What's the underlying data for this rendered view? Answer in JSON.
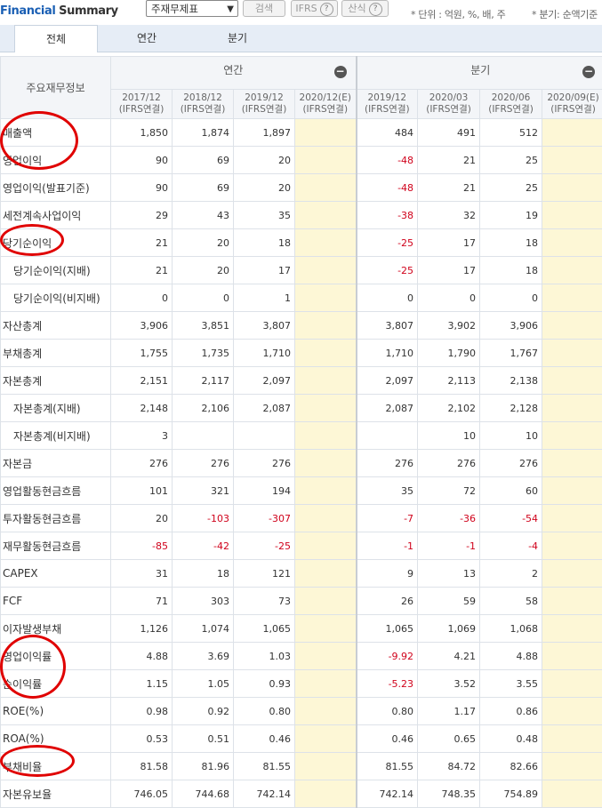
{
  "header": {
    "title_brand": "Financial",
    "title_rest": "Summary",
    "select_value": "주재무제표",
    "search_button": "검색",
    "ifrs_button": "IFRS",
    "formula_button": "산식",
    "help_mark": "?",
    "unit_note": "* 단위 : 억원, %, 배, 주",
    "quarter_note": "* 분기: 순액기준"
  },
  "tabs": [
    "전체",
    "연간",
    "분기"
  ],
  "table": {
    "corner_label": "주요재무정보",
    "group_annual": "연간",
    "group_quarter": "분기",
    "collapse_mark": "−",
    "periods": [
      {
        "date": "2017/12",
        "std": "(IFRS연결)"
      },
      {
        "date": "2018/12",
        "std": "(IFRS연결)"
      },
      {
        "date": "2019/12",
        "std": "(IFRS연결)"
      },
      {
        "date": "2020/12(E)",
        "std": "(IFRS연결)"
      },
      {
        "date": "2019/12",
        "std": "(IFRS연결)"
      },
      {
        "date": "2020/03",
        "std": "(IFRS연결)"
      },
      {
        "date": "2020/06",
        "std": "(IFRS연결)"
      },
      {
        "date": "2020/09(E)",
        "std": "(IFRS연결)"
      }
    ],
    "rows": [
      {
        "label": "매출액",
        "indent": false,
        "values": [
          "1,850",
          "1,874",
          "1,897",
          "",
          "484",
          "491",
          "512",
          ""
        ]
      },
      {
        "label": "영업이익",
        "indent": false,
        "values": [
          "90",
          "69",
          "20",
          "",
          "-48",
          "21",
          "25",
          ""
        ]
      },
      {
        "label": "영업이익(발표기준)",
        "indent": false,
        "values": [
          "90",
          "69",
          "20",
          "",
          "-48",
          "21",
          "25",
          ""
        ]
      },
      {
        "label": "세전계속사업이익",
        "indent": false,
        "values": [
          "29",
          "43",
          "35",
          "",
          "-38",
          "32",
          "19",
          ""
        ]
      },
      {
        "label": "당기순이익",
        "indent": false,
        "values": [
          "21",
          "20",
          "18",
          "",
          "-25",
          "17",
          "18",
          ""
        ]
      },
      {
        "label": "당기순이익(지배)",
        "indent": true,
        "values": [
          "21",
          "20",
          "17",
          "",
          "-25",
          "17",
          "18",
          ""
        ]
      },
      {
        "label": "당기순이익(비지배)",
        "indent": true,
        "values": [
          "0",
          "0",
          "1",
          "",
          "0",
          "0",
          "0",
          ""
        ]
      },
      {
        "label": "자산총계",
        "indent": false,
        "values": [
          "3,906",
          "3,851",
          "3,807",
          "",
          "3,807",
          "3,902",
          "3,906",
          ""
        ]
      },
      {
        "label": "부채총계",
        "indent": false,
        "values": [
          "1,755",
          "1,735",
          "1,710",
          "",
          "1,710",
          "1,790",
          "1,767",
          ""
        ]
      },
      {
        "label": "자본총계",
        "indent": false,
        "values": [
          "2,151",
          "2,117",
          "2,097",
          "",
          "2,097",
          "2,113",
          "2,138",
          ""
        ]
      },
      {
        "label": "자본총계(지배)",
        "indent": true,
        "values": [
          "2,148",
          "2,106",
          "2,087",
          "",
          "2,087",
          "2,102",
          "2,128",
          ""
        ]
      },
      {
        "label": "자본총계(비지배)",
        "indent": true,
        "values": [
          "3",
          "",
          "",
          "",
          "",
          "10",
          "10",
          ""
        ]
      },
      {
        "label": "자본금",
        "indent": false,
        "values": [
          "276",
          "276",
          "276",
          "",
          "276",
          "276",
          "276",
          ""
        ]
      },
      {
        "label": "영업활동현금흐름",
        "indent": false,
        "values": [
          "101",
          "321",
          "194",
          "",
          "35",
          "72",
          "60",
          ""
        ]
      },
      {
        "label": "투자활동현금흐름",
        "indent": false,
        "values": [
          "20",
          "-103",
          "-307",
          "",
          "-7",
          "-36",
          "-54",
          ""
        ]
      },
      {
        "label": "재무활동현금흐름",
        "indent": false,
        "values": [
          "-85",
          "-42",
          "-25",
          "",
          "-1",
          "-1",
          "-4",
          ""
        ]
      },
      {
        "label": "CAPEX",
        "indent": false,
        "values": [
          "31",
          "18",
          "121",
          "",
          "9",
          "13",
          "2",
          ""
        ]
      },
      {
        "label": "FCF",
        "indent": false,
        "values": [
          "71",
          "303",
          "73",
          "",
          "26",
          "59",
          "58",
          ""
        ]
      },
      {
        "label": "이자발생부채",
        "indent": false,
        "values": [
          "1,126",
          "1,074",
          "1,065",
          "",
          "1,065",
          "1,069",
          "1,068",
          ""
        ]
      },
      {
        "label": "영업이익률",
        "indent": false,
        "values": [
          "4.88",
          "3.69",
          "1.03",
          "",
          "-9.92",
          "4.21",
          "4.88",
          ""
        ]
      },
      {
        "label": "순이익률",
        "indent": false,
        "values": [
          "1.15",
          "1.05",
          "0.93",
          "",
          "-5.23",
          "3.52",
          "3.55",
          ""
        ]
      },
      {
        "label": "ROE(%)",
        "indent": false,
        "values": [
          "0.98",
          "0.92",
          "0.80",
          "",
          "0.80",
          "1.17",
          "0.86",
          ""
        ]
      },
      {
        "label": "ROA(%)",
        "indent": false,
        "values": [
          "0.53",
          "0.51",
          "0.46",
          "",
          "0.46",
          "0.65",
          "0.48",
          ""
        ]
      },
      {
        "label": "부채비율",
        "indent": false,
        "values": [
          "81.58",
          "81.96",
          "81.55",
          "",
          "81.55",
          "84.72",
          "82.66",
          ""
        ]
      },
      {
        "label": "자본유보율",
        "indent": false,
        "values": [
          "746.05",
          "744.68",
          "742.14",
          "",
          "742.14",
          "748.35",
          "754.89",
          ""
        ]
      }
    ]
  },
  "colors": {
    "brand_blue": "#1a5fb4",
    "negative_red": "#d0021b",
    "estimate_yellow": "#fdf7d6",
    "annotation_red": "#e00000"
  }
}
